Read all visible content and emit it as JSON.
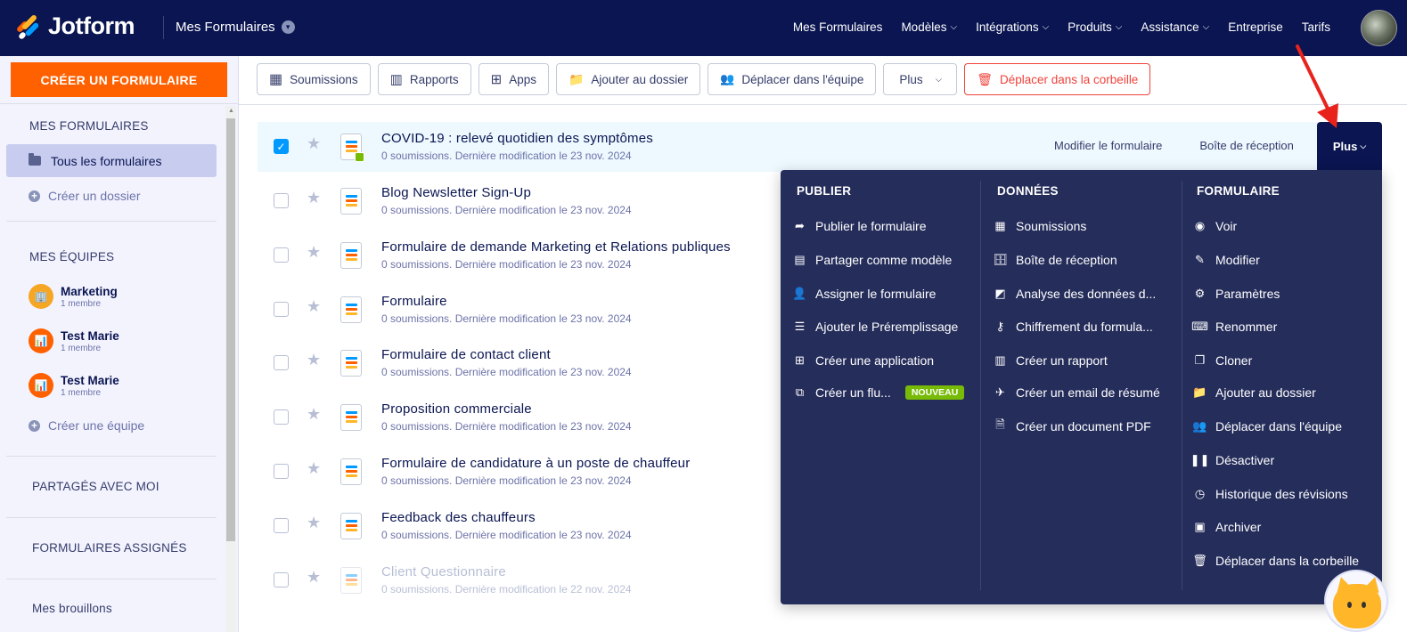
{
  "topbar": {
    "brand": "Jotform",
    "section_title": "Mes Formulaires",
    "nav": [
      {
        "label": "Mes Formulaires",
        "dropdown": false
      },
      {
        "label": "Modèles",
        "dropdown": true
      },
      {
        "label": "Intégrations",
        "dropdown": true
      },
      {
        "label": "Produits",
        "dropdown": true
      },
      {
        "label": "Assistance",
        "dropdown": true
      },
      {
        "label": "Entreprise",
        "dropdown": false
      },
      {
        "label": "Tarifs",
        "dropdown": false
      }
    ]
  },
  "sidebar": {
    "create_button": "CRÉER UN FORMULAIRE",
    "my_forms_heading": "MES FORMULAIRES",
    "all_forms": "Tous les formulaires",
    "create_folder": "Créer un dossier",
    "teams_heading": "MES ÉQUIPES",
    "teams": [
      {
        "name": "Marketing",
        "members": "1 membre",
        "color": "#f5a623"
      },
      {
        "name": "Test Marie",
        "members": "1 membre",
        "color": "#ff6100"
      },
      {
        "name": "Test Marie",
        "members": "1 membre",
        "color": "#ff6100"
      }
    ],
    "create_team": "Créer une équipe",
    "shared_with_me": "PARTAGÉS AVEC MOI",
    "assigned_forms": "FORMULAIRES ASSIGNÉS",
    "drafts": "Mes brouillons"
  },
  "toolbar": {
    "submissions": "Soumissions",
    "reports": "Rapports",
    "apps": "Apps",
    "add_to_folder": "Ajouter au dossier",
    "move_to_team": "Déplacer dans l'équipe",
    "more": "Plus",
    "trash": "Déplacer dans la corbeille"
  },
  "forms": [
    {
      "title": "COVID-19 : relevé quotidien des symptômes",
      "meta": "0 soumissions. Dernière modification le 23 nov. 2024",
      "selected": true
    },
    {
      "title": "Blog Newsletter Sign-Up",
      "meta": "0 soumissions. Dernière modification le 23 nov. 2024",
      "selected": false
    },
    {
      "title": "Formulaire de demande Marketing et Relations publiques",
      "meta": "0 soumissions. Dernière modification le 23 nov. 2024",
      "selected": false
    },
    {
      "title": "Formulaire",
      "meta": "0 soumissions. Dernière modification le 23 nov. 2024",
      "selected": false
    },
    {
      "title": "Formulaire de contact client",
      "meta": "0 soumissions. Dernière modification le 23 nov. 2024",
      "selected": false
    },
    {
      "title": "Proposition commerciale",
      "meta": "0 soumissions. Dernière modification le 23 nov. 2024",
      "selected": false
    },
    {
      "title": "Formulaire de candidature à un poste de chauffeur",
      "meta": "0 soumissions. Dernière modification le 23 nov. 2024",
      "selected": false
    },
    {
      "title": "Feedback des chauffeurs",
      "meta": "0 soumissions. Dernière modification le 23 nov. 2024",
      "selected": false
    },
    {
      "title": "Client Questionnaire",
      "meta": "0 soumissions. Dernière modification le 22 nov. 2024",
      "selected": false
    }
  ],
  "row_actions": {
    "edit": "Modifier le formulaire",
    "inbox": "Boîte de réception",
    "more": "Plus"
  },
  "dropdown": {
    "publish": {
      "heading": "PUBLIER",
      "items": [
        {
          "label": "Publier le formulaire",
          "icon": "share-arrow-icon"
        },
        {
          "label": "Partager comme modèle",
          "icon": "template-icon"
        },
        {
          "label": "Assigner le formulaire",
          "icon": "assign-user-icon"
        },
        {
          "label": "Ajouter le Préremplissage",
          "icon": "prefill-icon"
        },
        {
          "label": "Créer une application",
          "icon": "app-icon"
        },
        {
          "label": "Créer un flu...",
          "icon": "workflow-icon",
          "badge": "NOUVEAU"
        }
      ]
    },
    "data": {
      "heading": "DONNÉES",
      "items": [
        {
          "label": "Soumissions",
          "icon": "grid-icon"
        },
        {
          "label": "Boîte de réception",
          "icon": "inbox-icon"
        },
        {
          "label": "Analyse des données d...",
          "icon": "analytics-icon"
        },
        {
          "label": "Chiffrement du formula...",
          "icon": "key-icon"
        },
        {
          "label": "Créer un rapport",
          "icon": "report-icon"
        },
        {
          "label": "Créer un email de résumé",
          "icon": "send-icon"
        },
        {
          "label": "Créer un document PDF",
          "icon": "pdf-icon"
        }
      ]
    },
    "form": {
      "heading": "FORMULAIRE",
      "items": [
        {
          "label": "Voir",
          "icon": "eye-icon"
        },
        {
          "label": "Modifier",
          "icon": "edit-icon"
        },
        {
          "label": "Paramètres",
          "icon": "gear-icon"
        },
        {
          "label": "Renommer",
          "icon": "rename-icon"
        },
        {
          "label": "Cloner",
          "icon": "clone-icon"
        },
        {
          "label": "Ajouter au dossier",
          "icon": "folder-add-icon"
        },
        {
          "label": "Déplacer dans l'équipe",
          "icon": "team-move-icon"
        },
        {
          "label": "Désactiver",
          "icon": "pause-icon"
        },
        {
          "label": "Historique des révisions",
          "icon": "history-icon"
        },
        {
          "label": "Archiver",
          "icon": "archive-icon"
        },
        {
          "label": "Déplacer dans la corbeille",
          "icon": "trash-icon"
        }
      ]
    }
  },
  "colors": {
    "navy": "#0a1551",
    "orange": "#ff6100",
    "dropdown_bg": "#252d5b",
    "green": "#78bb07",
    "red": "#f0423b"
  }
}
